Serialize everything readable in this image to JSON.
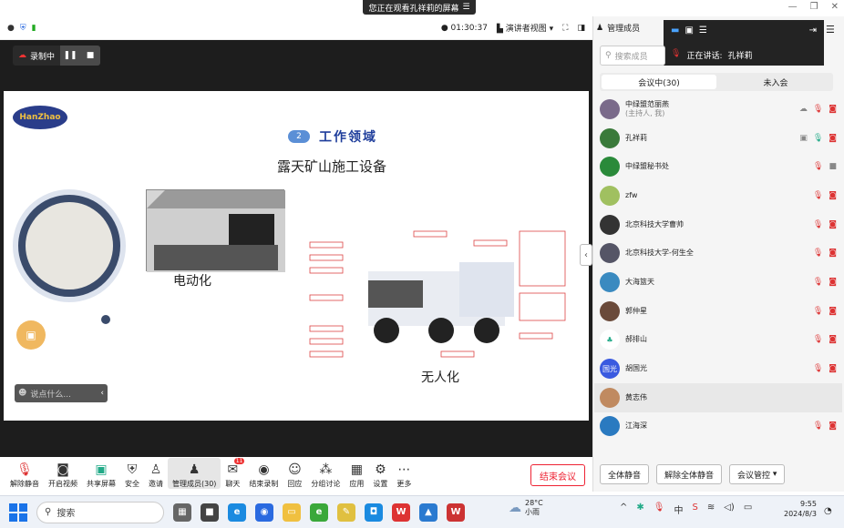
{
  "banner": {
    "text": "您正在观看孔祥莉的屏幕",
    "icon": "collapse-icon"
  },
  "topbar": {
    "timer": "01:30:37",
    "view_label": "演讲者视图"
  },
  "recording": {
    "label": "录制中"
  },
  "slide": {
    "logo": "HanZhao",
    "section_number": "2",
    "section_title": "工作领域",
    "subtitle": "露天矿山施工设备",
    "left_caption": "电动化",
    "right_caption": "无人化"
  },
  "chat": {
    "placeholder": "说点什么..."
  },
  "toolbar": {
    "items": [
      {
        "label": "解除静音",
        "icon": "mic-muted-icon"
      },
      {
        "label": "开启视频",
        "icon": "camera-off-icon"
      },
      {
        "label": "共享屏幕",
        "icon": "share-screen-icon"
      },
      {
        "label": "安全",
        "icon": "shield-icon"
      },
      {
        "label": "邀请",
        "icon": "invite-icon"
      },
      {
        "label": "管理成员(30)",
        "icon": "members-icon"
      },
      {
        "label": "聊天",
        "icon": "chat-icon",
        "badge": "11"
      },
      {
        "label": "结束录制",
        "icon": "stop-record-icon"
      },
      {
        "label": "回应",
        "icon": "reaction-icon"
      },
      {
        "label": "分组讨论",
        "icon": "breakout-icon"
      },
      {
        "label": "应用",
        "icon": "apps-icon"
      },
      {
        "label": "设置",
        "icon": "settings-icon"
      },
      {
        "label": "更多",
        "icon": "more-icon"
      }
    ],
    "end_label": "结束会议"
  },
  "panel": {
    "title": "管理成员",
    "search_placeholder": "搜索成员",
    "tab_in": "会议中(30)",
    "tab_out": "未入会",
    "speaking": {
      "label": "正在讲话:",
      "name": "孔祥莉"
    },
    "members": [
      {
        "name": "中绿盟范丽燕",
        "sub": "(主持人, 我)",
        "color": "#7a6a8a"
      },
      {
        "name": "孔祥莉",
        "sub": "",
        "color": "#3a7a3a"
      },
      {
        "name": "中绿盟秘书处",
        "sub": "",
        "color": "#2a8a3a"
      },
      {
        "name": "zfw",
        "sub": "",
        "color": "#a0c060"
      },
      {
        "name": "北京科技大学曹帅",
        "sub": "",
        "color": "#333"
      },
      {
        "name": "北京科技大学-何生全",
        "sub": "",
        "color": "#556"
      },
      {
        "name": "大海篮天",
        "sub": "",
        "color": "#3a8ac0"
      },
      {
        "name": "郭仲星",
        "sub": "",
        "color": "#6a4a3a"
      },
      {
        "name": "郝排山",
        "sub": "",
        "color": "#fff"
      },
      {
        "name": "胡国光",
        "sub": "",
        "color": "#3a5ae0",
        "initials": "国光"
      },
      {
        "name": "黄志伟",
        "sub": "",
        "color": "#c08a60"
      },
      {
        "name": "江海深",
        "sub": "",
        "color": "#2a7ac0"
      }
    ],
    "buttons": {
      "mute_all": "全体静音",
      "unmute_all": "解除全体静音",
      "control": "会议管控"
    }
  },
  "taskbar": {
    "search": "搜索",
    "weather_temp": "28°C",
    "weather_desc": "小雨",
    "time": "9:55",
    "date": "2024/8/3"
  }
}
